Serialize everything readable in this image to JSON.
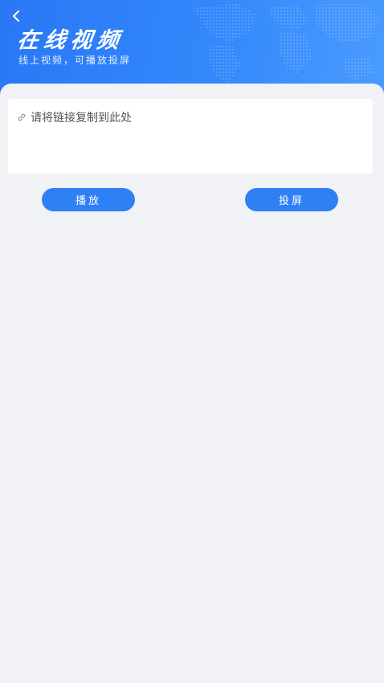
{
  "header": {
    "title": "在线视频",
    "subtitle": "线上视频，可播放投屏",
    "back_icon": "chevron-left-icon"
  },
  "link_input": {
    "placeholder": "请将链接复制到此处",
    "value": "",
    "icon": "link-icon"
  },
  "actions": {
    "play_label": "播放",
    "cast_label": "投屏"
  },
  "colors": {
    "header_start": "#2a77f5",
    "header_end": "#4a9bff",
    "button": "#2f80f5",
    "background": "#f0f2f5"
  }
}
